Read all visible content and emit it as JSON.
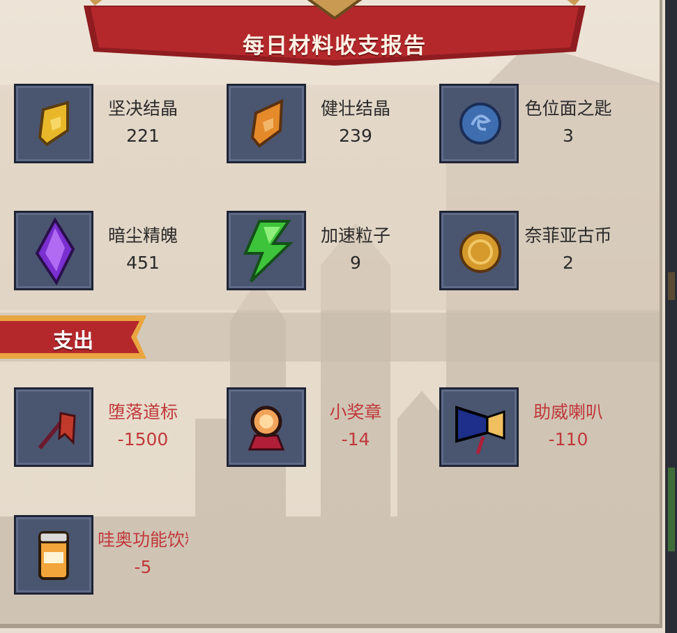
{
  "report": {
    "title": "每日材料收支报告"
  },
  "income_items": [
    {
      "name": "坚决结晶",
      "count": "221",
      "icon": "gold-crystal-icon"
    },
    {
      "name": "健壮结晶",
      "count": "239",
      "icon": "orange-crystal-icon"
    },
    {
      "name": "色位面之匙",
      "count": "3",
      "icon": "blue-key-coin-icon"
    },
    {
      "name": "暗尘精魄",
      "count": "451",
      "icon": "purple-shard-icon"
    },
    {
      "name": "加速粒子",
      "count": "9",
      "icon": "green-lightning-icon"
    },
    {
      "name": "奈菲亚古币",
      "count": "2",
      "icon": "gold-coin-icon"
    }
  ],
  "expense_section": {
    "label": "支出"
  },
  "expense_items": [
    {
      "name": "堕落道标",
      "count": "-1500",
      "icon": "red-flag-icon"
    },
    {
      "name": "小奖章",
      "count": "-14",
      "icon": "medal-icon"
    },
    {
      "name": "助威喇叭",
      "count": "-110",
      "icon": "horn-icon"
    },
    {
      "name": "哇奥功能饮料",
      "count": "-5",
      "icon": "drink-can-icon"
    }
  ],
  "colors": {
    "panel_bg": "#e8dfd2",
    "banner_red": "#b4282c",
    "icon_box": "#4a5570",
    "expense_text": "#c0393b"
  }
}
